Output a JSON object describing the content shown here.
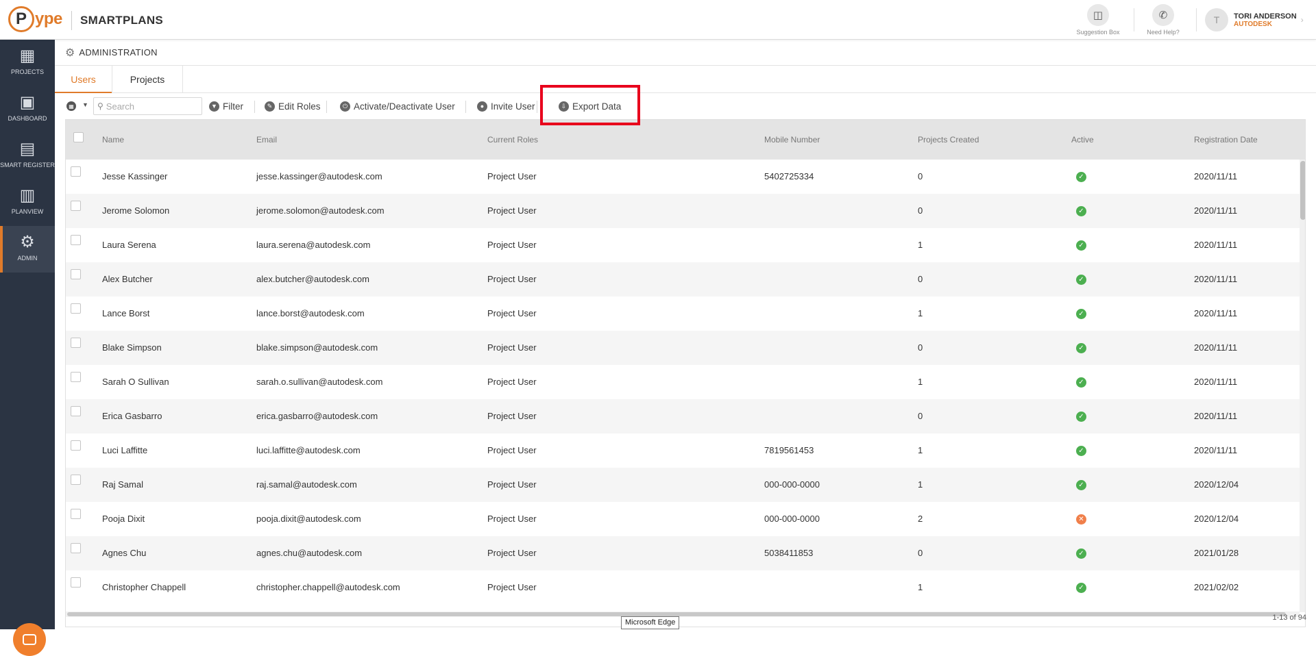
{
  "header": {
    "logo_letter": "P",
    "logo_text": "ype",
    "product": "SMARTPLANS",
    "suggestion_label": "Suggestion Box",
    "help_label": "Need Help?",
    "user_initial": "T",
    "user_name": "TORI ANDERSON",
    "user_org": "AUTODESK"
  },
  "sidebar": {
    "items": [
      {
        "label": "PROJECTS",
        "icon": "building-icon"
      },
      {
        "label": "DASHBOARD",
        "icon": "monitor-icon"
      },
      {
        "label": "SMART REGISTER",
        "icon": "register-icon"
      },
      {
        "label": "PLANVIEW",
        "icon": "planview-icon"
      },
      {
        "label": "ADMIN",
        "icon": "gear-icon"
      }
    ],
    "active": "ADMIN"
  },
  "admin_title": "ADMINISTRATION",
  "tabs": [
    {
      "label": "Users",
      "active": true
    },
    {
      "label": "Projects",
      "active": false
    }
  ],
  "toolbar": {
    "search_placeholder": "Search",
    "filter": "Filter",
    "edit_roles": "Edit Roles",
    "activate": "Activate/Deactivate User",
    "invite": "Invite User",
    "export": "Export Data"
  },
  "table": {
    "columns": [
      "Name",
      "Email",
      "Current Roles",
      "Mobile Number",
      "Projects Created",
      "Active",
      "Registration Date"
    ],
    "rows": [
      {
        "name": "Jesse Kassinger",
        "email": "jesse.kassinger@autodesk.com",
        "role": "Project User",
        "mobile": "5402725334",
        "projects": "0",
        "active": true,
        "date": "2020/11/11"
      },
      {
        "name": "Jerome Solomon",
        "email": "jerome.solomon@autodesk.com",
        "role": "Project User",
        "mobile": "",
        "projects": "0",
        "active": true,
        "date": "2020/11/11"
      },
      {
        "name": "Laura Serena",
        "email": "laura.serena@autodesk.com",
        "role": "Project User",
        "mobile": "",
        "projects": "1",
        "active": true,
        "date": "2020/11/11"
      },
      {
        "name": "Alex Butcher",
        "email": "alex.butcher@autodesk.com",
        "role": "Project User",
        "mobile": "",
        "projects": "0",
        "active": true,
        "date": "2020/11/11"
      },
      {
        "name": "Lance Borst",
        "email": "lance.borst@autodesk.com",
        "role": "Project User",
        "mobile": "",
        "projects": "1",
        "active": true,
        "date": "2020/11/11"
      },
      {
        "name": "Blake Simpson",
        "email": "blake.simpson@autodesk.com",
        "role": "Project User",
        "mobile": "",
        "projects": "0",
        "active": true,
        "date": "2020/11/11"
      },
      {
        "name": "Sarah O Sullivan",
        "email": "sarah.o.sullivan@autodesk.com",
        "role": "Project User",
        "mobile": "",
        "projects": "1",
        "active": true,
        "date": "2020/11/11"
      },
      {
        "name": "Erica Gasbarro",
        "email": "erica.gasbarro@autodesk.com",
        "role": "Project User",
        "mobile": "",
        "projects": "0",
        "active": true,
        "date": "2020/11/11"
      },
      {
        "name": "Luci Laffitte",
        "email": "luci.laffitte@autodesk.com",
        "role": "Project User",
        "mobile": "7819561453",
        "projects": "1",
        "active": true,
        "date": "2020/11/11"
      },
      {
        "name": "Raj Samal",
        "email": "raj.samal@autodesk.com",
        "role": "Project User",
        "mobile": "000-000-0000",
        "projects": "1",
        "active": true,
        "date": "2020/12/04"
      },
      {
        "name": "Pooja Dixit",
        "email": "pooja.dixit@autodesk.com",
        "role": "Project User",
        "mobile": "000-000-0000",
        "projects": "2",
        "active": false,
        "date": "2020/12/04"
      },
      {
        "name": "Agnes Chu",
        "email": "agnes.chu@autodesk.com",
        "role": "Project User",
        "mobile": "5038411853",
        "projects": "0",
        "active": true,
        "date": "2021/01/28"
      },
      {
        "name": "Christopher Chappell",
        "email": "christopher.chappell@autodesk.com",
        "role": "Project User",
        "mobile": "",
        "projects": "1",
        "active": true,
        "date": "2021/02/02"
      }
    ]
  },
  "pager": "1-13 of 94",
  "tooltip": "Microsoft Edge",
  "colors": {
    "accent": "#e07b2a",
    "sidebar": "#2b3443",
    "active_ok": "#4caf50",
    "active_bad": "#f07f4a",
    "highlight": "#e8001c"
  }
}
